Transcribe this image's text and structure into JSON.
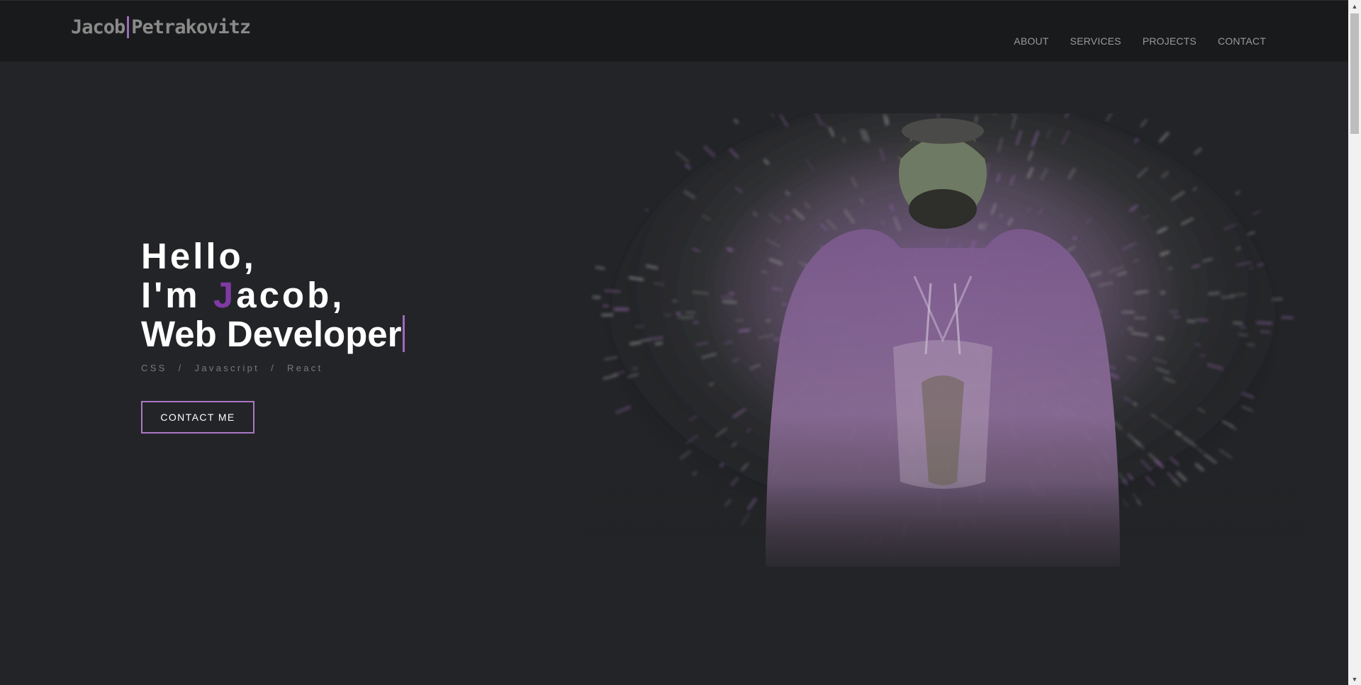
{
  "header": {
    "logo_first": "Jacob",
    "logo_last": "Petrakovitz",
    "nav": [
      {
        "label": "ABOUT"
      },
      {
        "label": "SERVICES"
      },
      {
        "label": "PROJECTS"
      },
      {
        "label": "CONTACT"
      }
    ]
  },
  "hero": {
    "line1": "Hello,",
    "line2_prefix": "I'm ",
    "line2_accent": "J",
    "line2_suffix": "acob,",
    "line3": "Web Developer",
    "skills": [
      "CSS",
      "/",
      "Javascript",
      "/",
      "React"
    ],
    "cta_label": "CONTACT ME"
  },
  "colors": {
    "accent": "#7f3aa3",
    "accent_border": "#a877c4",
    "background": "#232427",
    "header_bg": "#191a1b"
  },
  "icons": {
    "scroll_up": "scroll-up-arrow-icon",
    "scroll_down": "scroll-down-arrow-icon"
  }
}
